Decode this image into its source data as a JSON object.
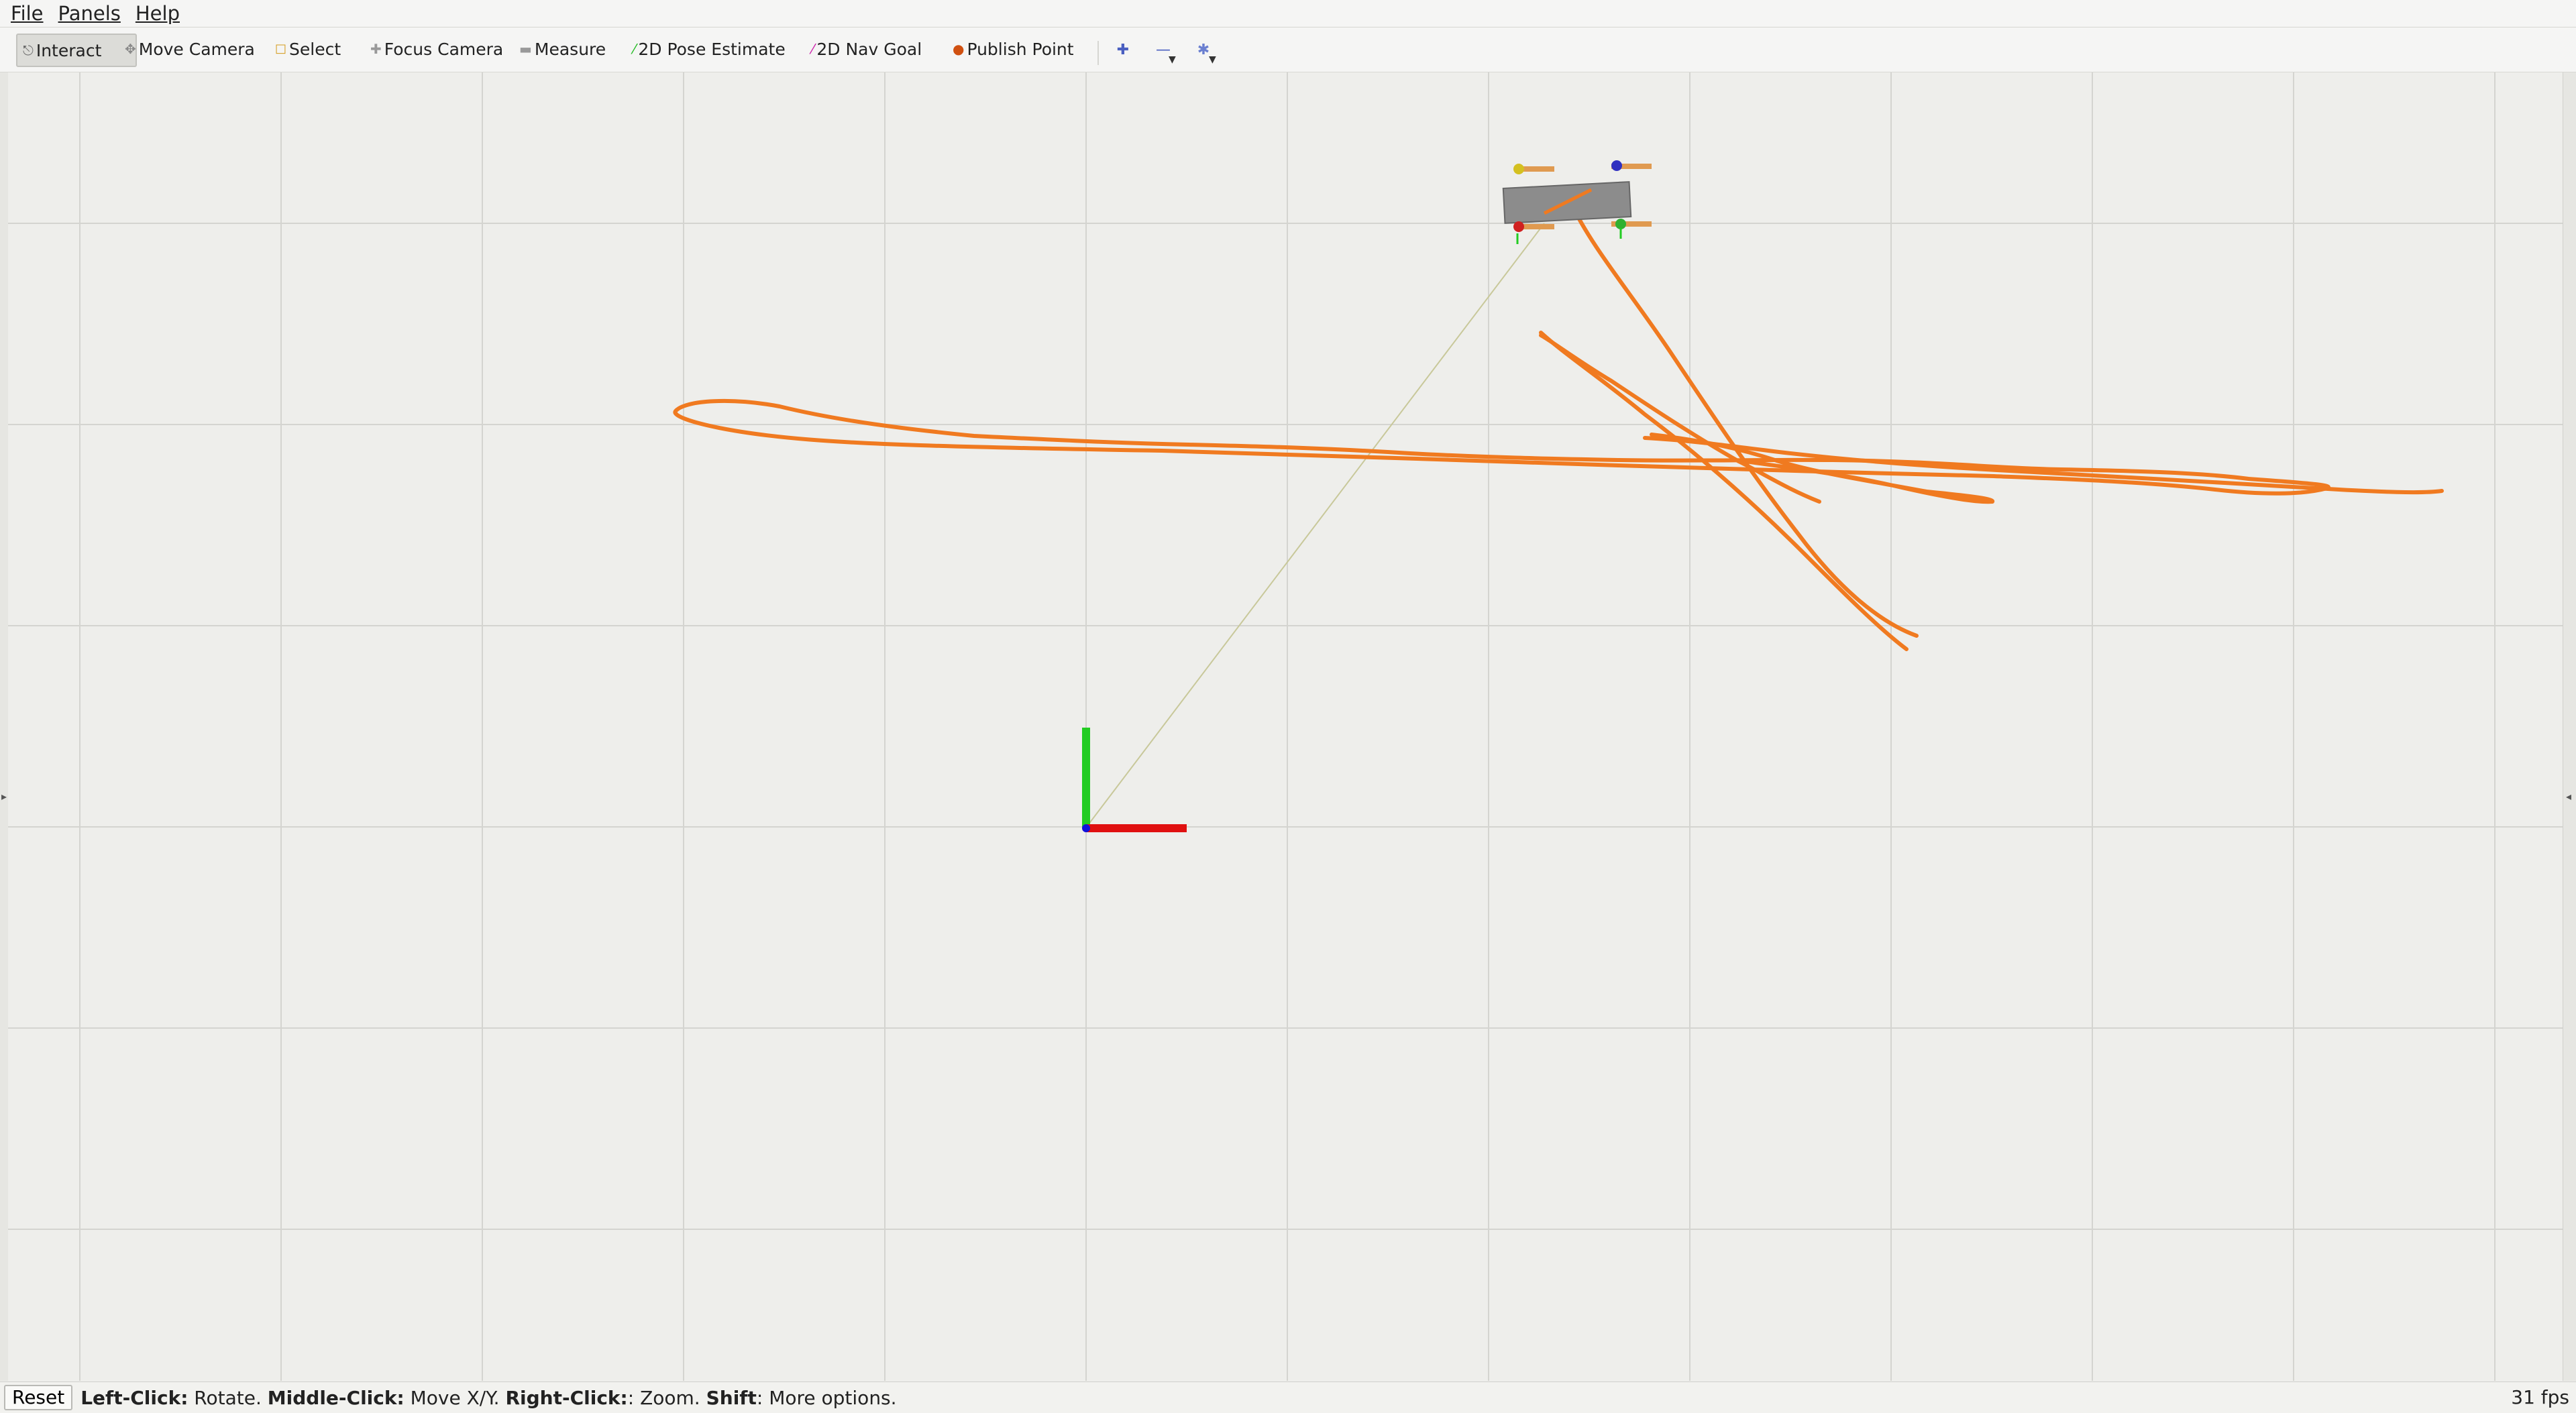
{
  "menubar": {
    "items": [
      "File",
      "Panels",
      "Help"
    ]
  },
  "toolbar": {
    "tools": [
      {
        "label": "Interact",
        "icon": "interact-icon",
        "active": true
      },
      {
        "label": "Move Camera",
        "icon": "move-camera-icon"
      },
      {
        "label": "Select",
        "icon": "select-icon"
      },
      {
        "label": "Focus Camera",
        "icon": "focus-camera-icon"
      },
      {
        "label": "Measure",
        "icon": "measure-icon"
      },
      {
        "label": "2D Pose Estimate",
        "icon": "pose-estimate-icon"
      },
      {
        "label": "2D Nav Goal",
        "icon": "nav-goal-icon"
      },
      {
        "label": "Publish Point",
        "icon": "publish-point-icon"
      }
    ],
    "extra_icons": [
      "add-tool-icon",
      "remove-tool-icon",
      "tool-properties-icon"
    ]
  },
  "viewport": {
    "background": "#eeeeeb",
    "grid_color": "#d4d4d0",
    "trajectory_color": "#f07a20",
    "axis_x_color": "#e01010",
    "axis_y_color": "#22cc22",
    "axis_z_color": "#1010dd",
    "tf_line_color": "#c8c89a"
  },
  "statusbar": {
    "reset_label": "Reset",
    "hint_left_click_key": "Left-Click:",
    "hint_left_click_action": " Rotate. ",
    "hint_middle_click_key": "Middle-Click:",
    "hint_middle_click_action": " Move X/Y. ",
    "hint_right_click_key": "Right-Click:",
    "hint_right_click_action": ": Zoom. ",
    "hint_shift_key": "Shift",
    "hint_shift_action": ": More options.",
    "fps": "31 fps"
  }
}
